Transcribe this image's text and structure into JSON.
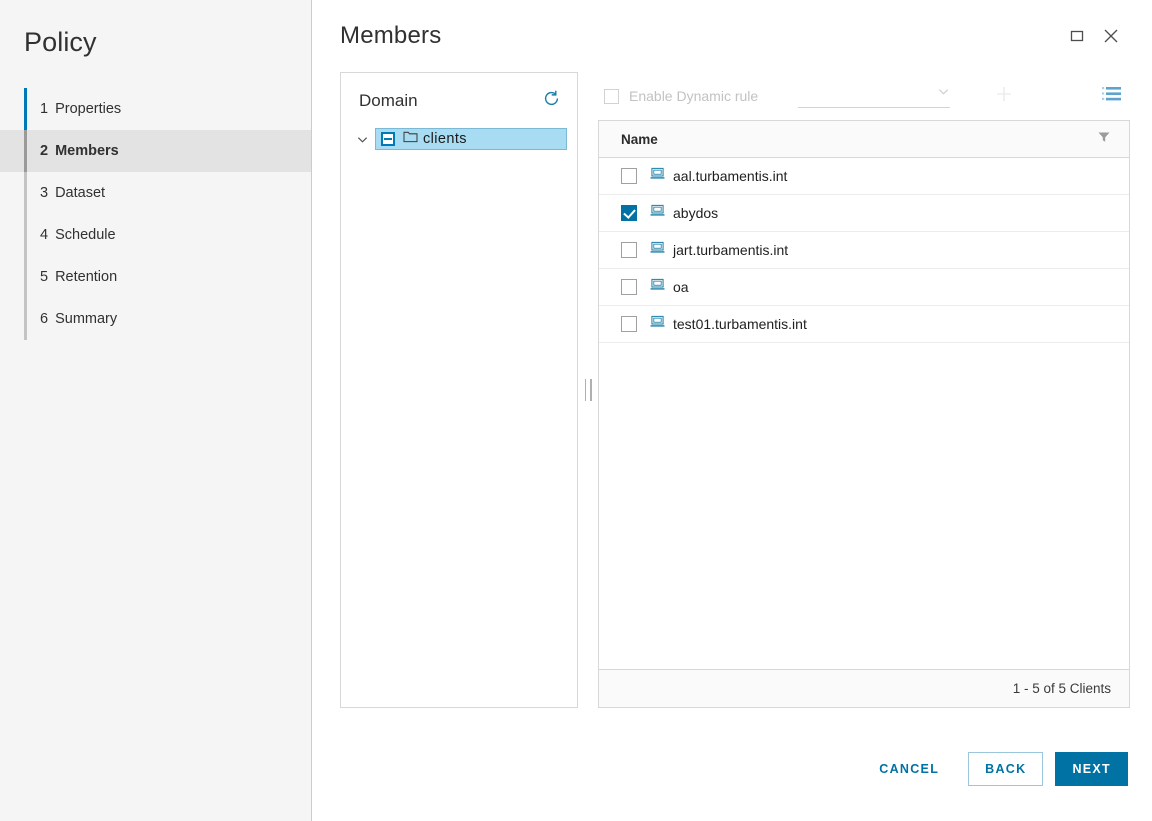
{
  "sidebar": {
    "title": "Policy",
    "items": [
      {
        "num": "1",
        "label": "Properties",
        "state": "done"
      },
      {
        "num": "2",
        "label": "Members",
        "state": "active"
      },
      {
        "num": "3",
        "label": "Dataset",
        "state": "pending"
      },
      {
        "num": "4",
        "label": "Schedule",
        "state": "pending"
      },
      {
        "num": "5",
        "label": "Retention",
        "state": "pending"
      },
      {
        "num": "6",
        "label": "Summary",
        "state": "pending"
      }
    ]
  },
  "header": {
    "title": "Members",
    "maximize_icon": "maximize-icon",
    "close_icon": "close-icon"
  },
  "domain": {
    "title": "Domain",
    "refresh_icon": "refresh-icon",
    "tree": [
      {
        "label": "clients",
        "icon": "folder-icon",
        "checkbox_state": "indeterminate",
        "expanded": true,
        "selected": true
      }
    ]
  },
  "splitter": {
    "name": "panel-splitter"
  },
  "rule_bar": {
    "checkbox_label": "Enable Dynamic rule",
    "checkbox_checked": false,
    "checkbox_disabled": true,
    "select_value": "",
    "select_placeholder": "",
    "add_icon": "plus-icon",
    "list_icon": "list-view-icon"
  },
  "table": {
    "columns": [
      "Name"
    ],
    "filter_icon": "filter-icon",
    "rows": [
      {
        "name": "aal.turbamentis.int",
        "checked": false,
        "icon": "computer-icon"
      },
      {
        "name": "abydos",
        "checked": true,
        "icon": "computer-icon"
      },
      {
        "name": "jart.turbamentis.int",
        "checked": false,
        "icon": "computer-icon"
      },
      {
        "name": "oa",
        "checked": false,
        "icon": "computer-icon"
      },
      {
        "name": "test01.turbamentis.int",
        "checked": false,
        "icon": "computer-icon"
      }
    ],
    "footer_text": "1 - 5 of 5 Clients"
  },
  "footer": {
    "cancel_label": "CANCEL",
    "back_label": "BACK",
    "next_label": "NEXT"
  },
  "colors": {
    "accent": "#0072a3",
    "accent_bright": "#0079b8",
    "selection": "#a7dcf2",
    "active_row": "#e3e3e3",
    "sidebar_bg": "#f5f5f5",
    "text": "#313131",
    "disabled": "#c2c2c2"
  }
}
